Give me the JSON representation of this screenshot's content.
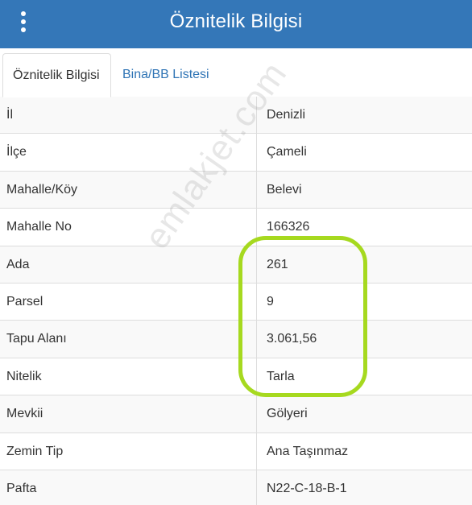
{
  "header": {
    "title": "Öznitelik Bilgisi",
    "menu_icon": "vertical-ellipsis-icon",
    "background_color": "#3477b8"
  },
  "tabs": [
    {
      "label": "Öznitelik Bilgisi",
      "active": true
    },
    {
      "label": "Bina/BB Listesi",
      "active": false
    }
  ],
  "attributes": [
    {
      "label": "İl",
      "value": "Denizli"
    },
    {
      "label": "İlçe",
      "value": "Çameli"
    },
    {
      "label": "Mahalle/Köy",
      "value": "Belevi"
    },
    {
      "label": "Mahalle No",
      "value": "166326"
    },
    {
      "label": "Ada",
      "value": "261"
    },
    {
      "label": "Parsel",
      "value": "9"
    },
    {
      "label": "Tapu Alanı",
      "value": "3.061,56"
    },
    {
      "label": "Nitelik",
      "value": "Tarla"
    },
    {
      "label": "Mevkii",
      "value": "Gölyeri"
    },
    {
      "label": "Zemin Tip",
      "value": "Ana Taşınmaz"
    },
    {
      "label": "Pafta",
      "value": "N22-C-18-B-1"
    }
  ],
  "watermark": "emlakjet.com",
  "highlight_color": "#a6d91f"
}
